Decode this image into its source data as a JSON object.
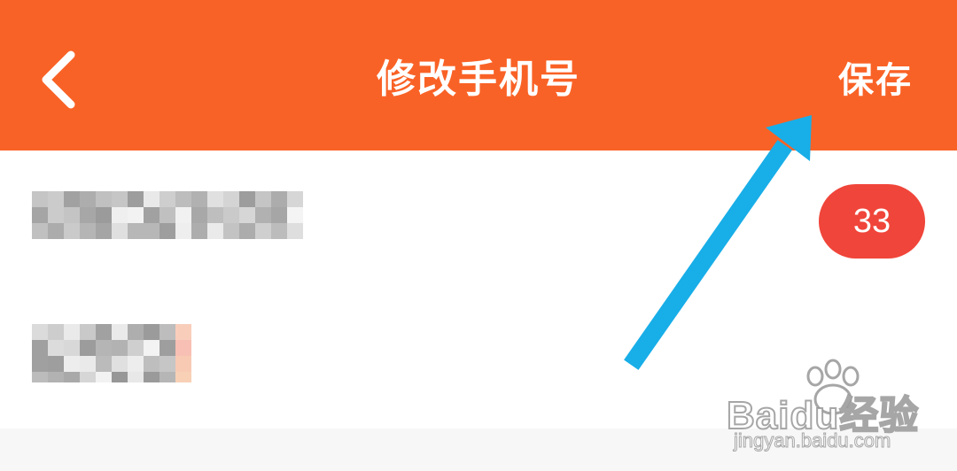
{
  "header": {
    "title": "修改手机号",
    "save_label": "保存",
    "back_icon": "chevron-left-icon",
    "background_color": "#f96226"
  },
  "content": {
    "count_badge": "33",
    "badge_color": "#f0453a"
  },
  "annotation": {
    "arrow_color": "#18aee8",
    "arrow_icon": "arrow-up-right-icon"
  },
  "watermark": {
    "brand": "Baidu经验",
    "url": "jingyan.baidu.com"
  }
}
